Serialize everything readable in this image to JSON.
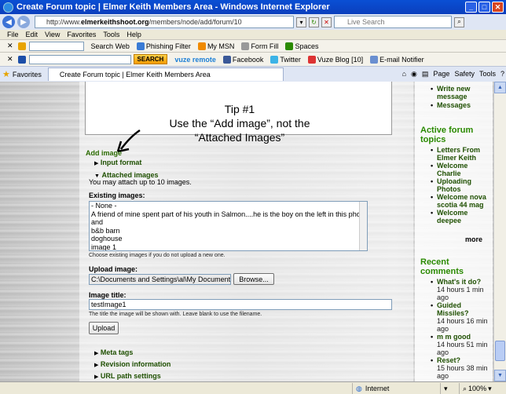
{
  "window": {
    "title": "Create Forum topic | Elmer Keith Members Area - Windows Internet Explorer"
  },
  "address": {
    "url_prefix": "http://www.",
    "url_host": "elmerkeithshoot.org",
    "url_path": "/members/node/add/forum/10",
    "search_placeholder": "Live Search"
  },
  "menu": [
    "File",
    "Edit",
    "View",
    "Favorites",
    "Tools",
    "Help"
  ],
  "toolbar1": {
    "search_web": "Search Web",
    "phishing": "Phishing Filter",
    "mymsn": "My MSN",
    "formfill": "Form Fill",
    "spaces": "Spaces"
  },
  "toolbar2": {
    "search_btn": "SEARCH",
    "vuze": "vuze remote",
    "facebook": "Facebook",
    "twitter": "Twitter",
    "vuzeblog": "Vuze Blog [10]",
    "email": "E-mail Notifier"
  },
  "favbar": {
    "favorites": "Favorites",
    "tab_title": "Create Forum topic | Elmer Keith Members Area",
    "page": "Page",
    "safety": "Safety",
    "tools": "Tools"
  },
  "annotation": {
    "line1": "Tip #1",
    "line2": "Use the “Add image”, not the",
    "line3": "“Attached Images”"
  },
  "form": {
    "add_image": "Add image",
    "input_format": "Input format",
    "attached_images": "Attached images",
    "attach_note": "You may attach up to 10 images.",
    "existing_label": "Existing images:",
    "existing_options": [
      "- None -",
      "A friend of mine spent part of his youth in Salmon....he is the boy on the left in this photo",
      "and",
      "b&b barn",
      "doghouse",
      "image 1"
    ],
    "existing_desc": "Choose existing images if you do not upload a new one.",
    "upload_label": "Upload image:",
    "upload_value": "C:\\Documents and Settings\\al\\My Documents\\",
    "browse": "Browse...",
    "title_label": "Image title:",
    "title_value": "testImage1",
    "title_desc": "The title the image will be shown with. Leave blank to use the filename.",
    "upload_btn": "Upload",
    "meta_tags": "Meta tags",
    "revision": "Revision information",
    "url_path": "URL path settings"
  },
  "sidebar": {
    "nav_items": [
      "Write new message",
      "Messages"
    ],
    "active_title": "Active forum topics",
    "active_items": [
      "Letters From Elmer Keith",
      "Welcome Charlie",
      "Uploading Photos",
      "Welcome nova scotia 44 mag",
      "Welcome deepee"
    ],
    "more": "more",
    "recent_title": "Recent comments",
    "recent_items": [
      {
        "title": "What's it do?",
        "time": "14 hours 1 min ago"
      },
      {
        "title": "Guided Missiles?",
        "time": "14 hours 16 min ago"
      },
      {
        "title": "m m good",
        "time": "14 hours 51 min ago"
      },
      {
        "title": "Reset?",
        "time": "15 hours 38 min ago"
      }
    ]
  },
  "status": {
    "zone": "Internet",
    "zoom": "100%"
  }
}
